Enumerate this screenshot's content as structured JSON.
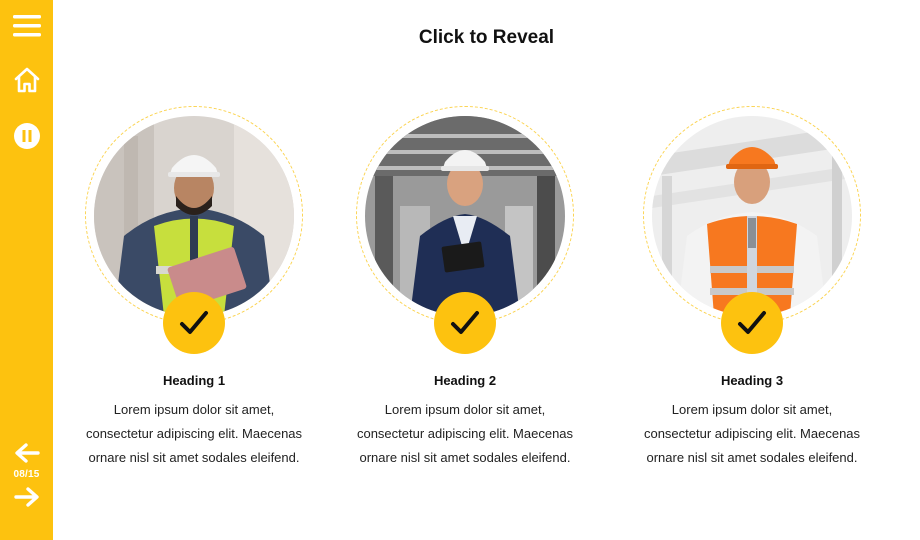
{
  "title": "Click to Reveal",
  "sidebar": {
    "icons": [
      "menu-icon",
      "home-icon",
      "pause-icon",
      "arrow-left-icon",
      "arrow-right-icon"
    ],
    "page_counter": "08/15"
  },
  "cards": [
    {
      "heading": "Heading 1",
      "lines": [
        "Lorem ipsum dolor sit amet,",
        "consectetur adipiscing elit. Maecenas",
        "ornare nisl sit amet sodales eleifend."
      ]
    },
    {
      "heading": "Heading 2",
      "lines": [
        "Lorem ipsum dolor sit amet,",
        "consectetur adipiscing elit. Maecenas",
        "ornare nisl sit amet sodales eleifend."
      ]
    },
    {
      "heading": "Heading 3",
      "lines": [
        "Lorem ipsum dolor sit amet,",
        "consectetur adipiscing elit. Maecenas",
        "ornare nisl sit amet sodales eleifend."
      ]
    }
  ],
  "colors": {
    "accent": "#FDC20F",
    "ring": "#FBD453",
    "text": "#111111"
  }
}
